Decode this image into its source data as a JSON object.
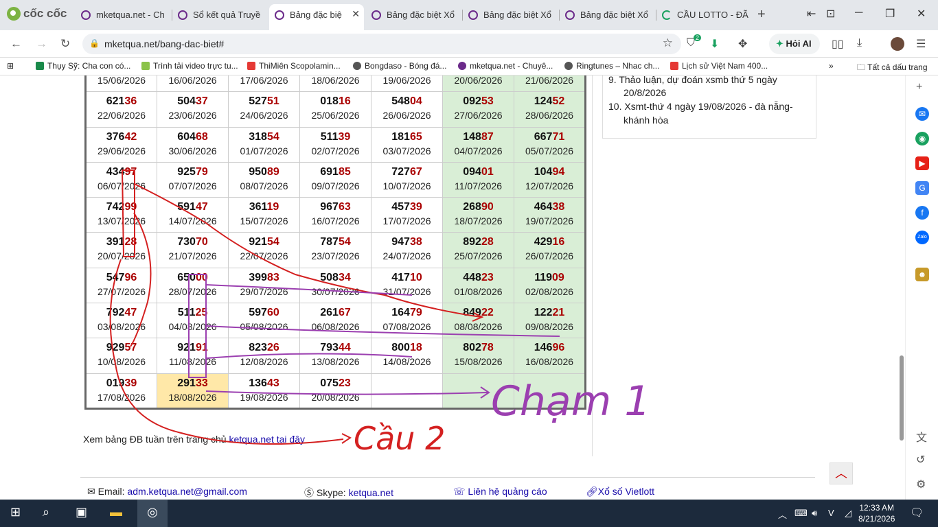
{
  "browser": {
    "brand": "cốc cốc",
    "tabs": [
      {
        "title": "mketqua.net - Ch",
        "icon": "ketqua-favicon"
      },
      {
        "title": "Sổ kết quả Truyề",
        "icon": "ketqua-favicon"
      },
      {
        "title": "Bảng đặc biệ",
        "icon": "ketqua-favicon",
        "active": true
      },
      {
        "title": "Bảng đặc biệt Xổ",
        "icon": "ketqua-favicon"
      },
      {
        "title": "Bảng đặc biệt Xổ",
        "icon": "ketqua-favicon"
      },
      {
        "title": "Bảng đặc biệt Xổ",
        "icon": "ketqua-favicon"
      },
      {
        "title": "CẦU LOTTO - ĐÃ",
        "icon": "loading-spinner-icon"
      }
    ],
    "url": "mketqua.net/bang-dac-biet#",
    "extension_badge": "2",
    "ai_button": "Hỏi AI",
    "bookmarks": [
      {
        "label": "Thụy Sỹ: Cha con có...",
        "color": "#1a8a4a"
      },
      {
        "label": "Trình tải video trực tu...",
        "color": "#8bc34a"
      },
      {
        "label": "ThiMiên Scopolamin...",
        "color": "#e53935"
      },
      {
        "label": "Bongdaso - Bóng đá...",
        "color": "#555555"
      },
      {
        "label": "mketqua.net - Chuyê...",
        "color": "#6b2a8a"
      },
      {
        "label": "Ringtunes – Nhac ch...",
        "color": "#555555"
      },
      {
        "label": "Lịch sử Việt Nam 400...",
        "color": "#e53935"
      }
    ],
    "all_bookmarks": "Tất cả dấu trang"
  },
  "table": {
    "rows": [
      [
        {
          "h": "",
          "t": "",
          "d": "15/06/2026"
        },
        {
          "h": "",
          "t": "",
          "d": "16/06/2026"
        },
        {
          "h": "",
          "t": "",
          "d": "17/06/2026"
        },
        {
          "h": "",
          "t": "",
          "d": "18/06/2026"
        },
        {
          "h": "",
          "t": "",
          "d": "19/06/2026"
        },
        {
          "h": "",
          "t": "",
          "d": "20/06/2026"
        },
        {
          "h": "",
          "t": "",
          "d": "21/06/2026"
        }
      ],
      [
        {
          "h": "621",
          "t": "36",
          "d": "22/06/2026"
        },
        {
          "h": "504",
          "t": "37",
          "d": "23/06/2026"
        },
        {
          "h": "527",
          "t": "51",
          "d": "24/06/2026"
        },
        {
          "h": "018",
          "t": "16",
          "d": "25/06/2026"
        },
        {
          "h": "548",
          "t": "04",
          "d": "26/06/2026"
        },
        {
          "h": "092",
          "t": "53",
          "d": "27/06/2026"
        },
        {
          "h": "124",
          "t": "52",
          "d": "28/06/2026"
        }
      ],
      [
        {
          "h": "376",
          "t": "42",
          "d": "29/06/2026"
        },
        {
          "h": "604",
          "t": "68",
          "d": "30/06/2026"
        },
        {
          "h": "318",
          "t": "54",
          "d": "01/07/2026"
        },
        {
          "h": "511",
          "t": "39",
          "d": "02/07/2026"
        },
        {
          "h": "181",
          "t": "65",
          "d": "03/07/2026"
        },
        {
          "h": "148",
          "t": "87",
          "d": "04/07/2026"
        },
        {
          "h": "667",
          "t": "71",
          "d": "05/07/2026"
        }
      ],
      [
        {
          "h": "434",
          "t": "97",
          "d": "06/07/2026"
        },
        {
          "h": "925",
          "t": "79",
          "d": "07/07/2026"
        },
        {
          "h": "950",
          "t": "89",
          "d": "08/07/2026"
        },
        {
          "h": "691",
          "t": "85",
          "d": "09/07/2026"
        },
        {
          "h": "727",
          "t": "67",
          "d": "10/07/2026"
        },
        {
          "h": "094",
          "t": "01",
          "d": "11/07/2026"
        },
        {
          "h": "104",
          "t": "94",
          "d": "12/07/2026"
        }
      ],
      [
        {
          "h": "742",
          "t": "99",
          "d": "13/07/2026"
        },
        {
          "h": "591",
          "t": "47",
          "d": "14/07/2026"
        },
        {
          "h": "361",
          "t": "19",
          "d": "15/07/2026"
        },
        {
          "h": "967",
          "t": "63",
          "d": "16/07/2026"
        },
        {
          "h": "457",
          "t": "39",
          "d": "17/07/2026"
        },
        {
          "h": "268",
          "t": "90",
          "d": "18/07/2026"
        },
        {
          "h": "464",
          "t": "38",
          "d": "19/07/2026"
        }
      ],
      [
        {
          "h": "391",
          "t": "28",
          "d": "20/07/2026"
        },
        {
          "h": "730",
          "t": "70",
          "d": "21/07/2026"
        },
        {
          "h": "921",
          "t": "54",
          "d": "22/07/2026"
        },
        {
          "h": "787",
          "t": "54",
          "d": "23/07/2026"
        },
        {
          "h": "947",
          "t": "38",
          "d": "24/07/2026"
        },
        {
          "h": "892",
          "t": "28",
          "d": "25/07/2026"
        },
        {
          "h": "429",
          "t": "16",
          "d": "26/07/2026"
        }
      ],
      [
        {
          "h": "547",
          "t": "96",
          "d": "27/07/2026"
        },
        {
          "h": "650",
          "t": "00",
          "d": "28/07/2026"
        },
        {
          "h": "399",
          "t": "83",
          "d": "29/07/2026"
        },
        {
          "h": "508",
          "t": "34",
          "d": "30/07/2026"
        },
        {
          "h": "417",
          "t": "10",
          "d": "31/07/2026"
        },
        {
          "h": "448",
          "t": "23",
          "d": "01/08/2026"
        },
        {
          "h": "119",
          "t": "09",
          "d": "02/08/2026"
        }
      ],
      [
        {
          "h": "792",
          "t": "47",
          "d": "03/08/2026"
        },
        {
          "h": "511",
          "t": "25",
          "d": "04/08/2026"
        },
        {
          "h": "597",
          "t": "60",
          "d": "05/08/2026"
        },
        {
          "h": "261",
          "t": "67",
          "d": "06/08/2026"
        },
        {
          "h": "164",
          "t": "79",
          "d": "07/08/2026"
        },
        {
          "h": "849",
          "t": "22",
          "d": "08/08/2026"
        },
        {
          "h": "122",
          "t": "21",
          "d": "09/08/2026"
        }
      ],
      [
        {
          "h": "929",
          "t": "57",
          "d": "10/08/2026"
        },
        {
          "h": "921",
          "t": "91",
          "d": "11/08/2026"
        },
        {
          "h": "823",
          "t": "26",
          "d": "12/08/2026"
        },
        {
          "h": "793",
          "t": "44",
          "d": "13/08/2026"
        },
        {
          "h": "800",
          "t": "18",
          "d": "14/08/2026"
        },
        {
          "h": "802",
          "t": "78",
          "d": "15/08/2026"
        },
        {
          "h": "146",
          "t": "96",
          "d": "16/08/2026"
        }
      ],
      [
        {
          "h": "019",
          "t": "39",
          "d": "17/08/2026"
        },
        {
          "h": "291",
          "t": "33",
          "d": "18/08/2026",
          "today": true
        },
        {
          "h": "136",
          "t": "43",
          "d": "19/08/2026"
        },
        {
          "h": "075",
          "t": "23",
          "d": "20/08/2026"
        },
        {
          "h": "",
          "t": "",
          "d": ""
        },
        {
          "h": "",
          "t": "",
          "d": ""
        },
        {
          "h": "",
          "t": "",
          "d": ""
        }
      ]
    ]
  },
  "see_more": {
    "text": "Xem bảng ĐB tuần trên trang chủ ",
    "link": "ketqua.net tại đây"
  },
  "right_list": [
    {
      "n": "9.",
      "line1": "Thảo luận, dự đoán xsmb thứ 5 ngày",
      "line2": "20/8/2026"
    },
    {
      "n": "10.",
      "line1": "Xsmt-thứ 4 ngày 19/08/2026 - đà nẵng-",
      "line2": "khánh hòa"
    }
  ],
  "footer": {
    "email_label": "Email:",
    "email": "adm.ketqua.net@gmail.com",
    "skype_label": "Skype:",
    "skype": "ketqua.net",
    "ads": "Liên hệ quảng cáo",
    "vietlott": "Xổ số Vietlott"
  },
  "annotations": {
    "red_text": "Cầu 2",
    "purple_text": "Chạm 1",
    "red_color": "#d42020",
    "purple_color": "#9b3fb0"
  },
  "taskbar": {
    "time": "12:33 AM",
    "date": "8/21/2026"
  },
  "colors": {
    "weekend_bg": "#d9eed6",
    "today_bg": "#ffe8a8",
    "tail_red": "#a00000"
  }
}
